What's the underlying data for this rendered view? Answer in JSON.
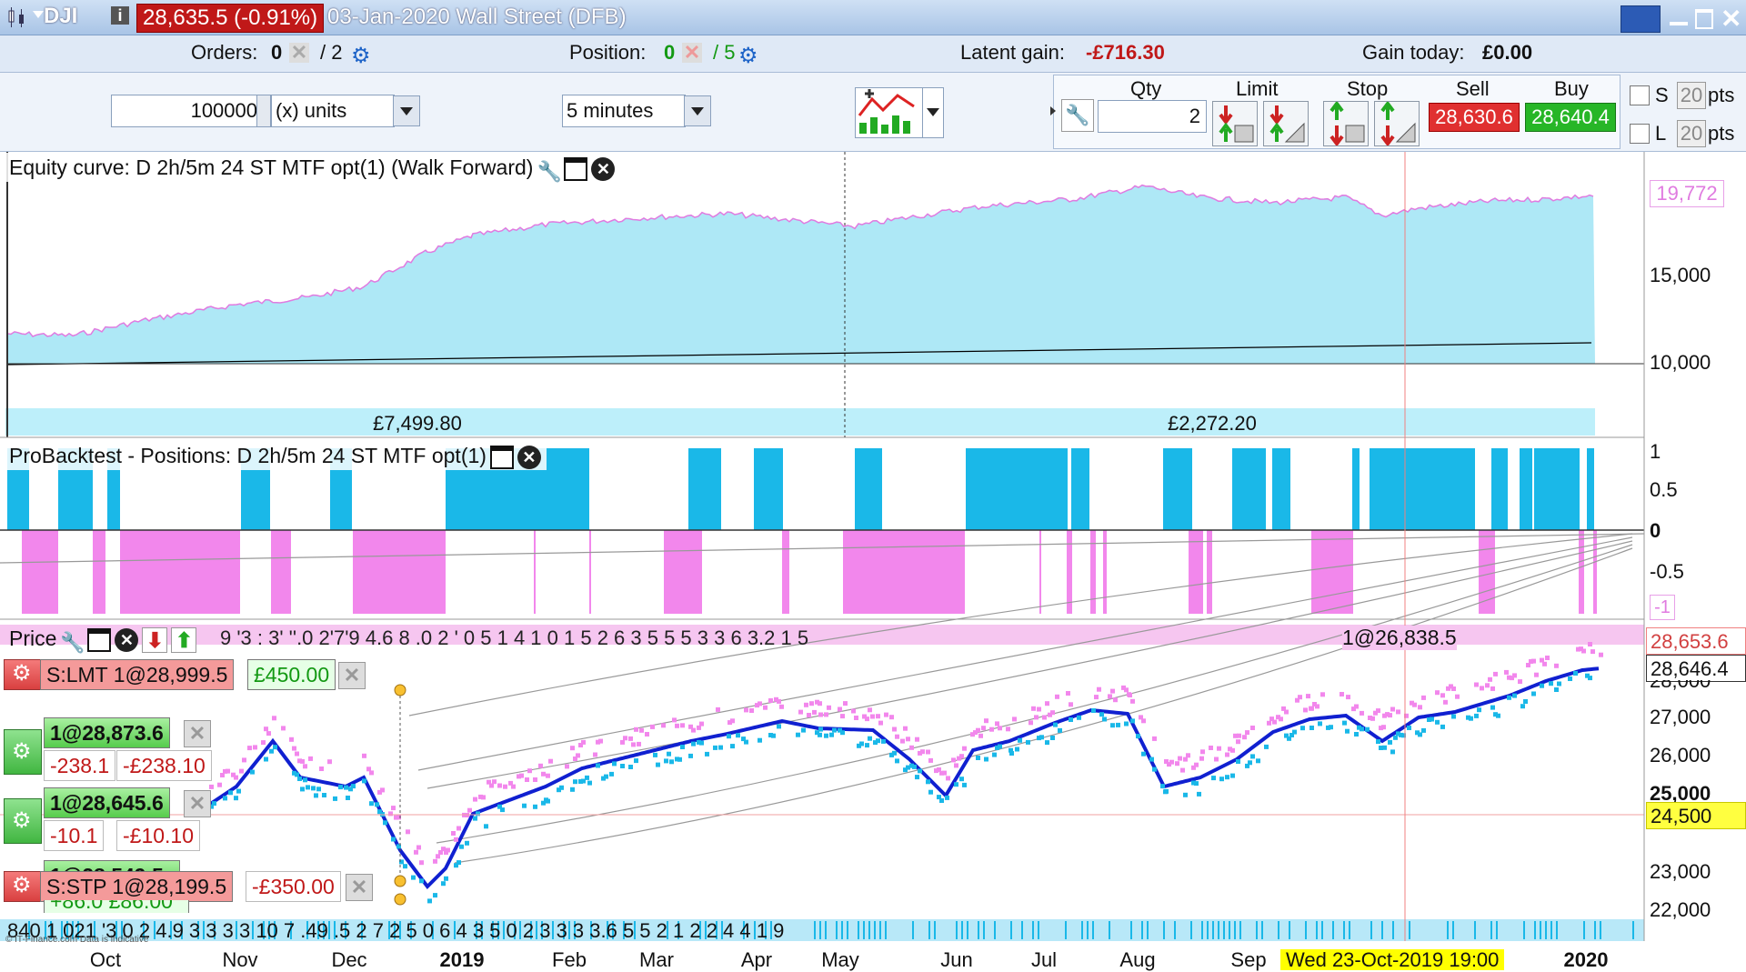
{
  "titlebar": {
    "symbol": "DJI",
    "info_icon": "i",
    "price_change": "28,635.5 (-0.91%)",
    "instrument": "03-Jan-2020 Wall Street (DFB)"
  },
  "infobar": {
    "orders_label": "Orders:",
    "orders_value": "0",
    "orders_total": "/ 2",
    "position_label": "Position:",
    "position_value": "0",
    "position_total": "/ 5",
    "latent_label": "Latent gain:",
    "latent_value": "-£716.30",
    "gaintoday_label": "Gain today:",
    "gaintoday_value": "£0.00"
  },
  "controls": {
    "quantity": "100000",
    "units": "(x) units",
    "timeframe": "5 minutes"
  },
  "trade": {
    "qty_label": "Qty",
    "qty_value": "2",
    "limit_label": "Limit",
    "stop_label": "Stop",
    "sell_label": "Sell",
    "buy_label": "Buy",
    "sell_price": "28,630.6",
    "buy_price": "28,640.4",
    "s_label": "S",
    "l_label": "L",
    "s_pts": "20",
    "l_pts": "20",
    "pts_label": "pts"
  },
  "equity_panel": {
    "title": "Equity curve: D 2h/5m 24 ST MTF opt(1) (Walk Forward)",
    "current_value": "19,772",
    "ticks": [
      "15,000",
      "10,000"
    ],
    "segment_gains": [
      "£7,499.80",
      "£2,272.20"
    ]
  },
  "positions_panel": {
    "title": "ProBacktest - Positions: D 2h/5m 24 ST MTF opt(1)",
    "ticks": [
      "1",
      "0.5",
      "0",
      "-0.5",
      "-1"
    ]
  },
  "price_panel": {
    "title": "Price",
    "strip_text": "9   '3   :   3' ''.0  2'7'9   4.6 8  .0   2    '   0   5  1 4 1    0 1 5 2 6   3   5 5  5 3 3 6 3.2 1 5",
    "strip_mark": "1@26,838.5",
    "last_price": "28,653.6",
    "bid_price": "28,646.4",
    "hline_price": "24,500",
    "ticks": [
      "27,000",
      "26,000",
      "25,000",
      "23,000",
      "22,000"
    ],
    "partial_tick": "28,000",
    "bottom_strip": "840 1 021   '3 0 2 4.9    3    3 3 3    10 7    .49   .5     2 7 2 5   0 6  4 3      5 0     2 3   3   3 3.6 5        5    2     1 2      2 4 4    1 9",
    "orders": [
      {
        "label": "S:LMT 1@28,999.5",
        "gain": "£450.00"
      },
      {
        "label": "1@28,873.6",
        "pts": "-238.1",
        "gain": "-£238.10"
      },
      {
        "label": "1@28,645.6",
        "pts": "-10.1",
        "gain": "-£10.10"
      },
      {
        "label": "S:STP 1@28,199.5",
        "gain": "-£350.00"
      }
    ],
    "hidden_order": "1@28,549.5",
    "hidden_gain": "+86.0  £86.00"
  },
  "xaxis": {
    "months": [
      "Oct",
      "Nov",
      "Dec",
      "2019",
      "Feb",
      "Mar",
      "Apr",
      "May",
      "Jun",
      "Jul",
      "Aug",
      "Sep",
      "2020"
    ],
    "cursor_date": "Wed 23-Oct-2019 19:00",
    "copyright": "© IT-Finance.com Data is indicative"
  },
  "colors": {
    "equity_fill": "#aee8f6",
    "long": "#1ab8e8",
    "short": "#f287ec",
    "ma": "#1020d0",
    "cursor_date_bg": "#ffff00"
  }
}
